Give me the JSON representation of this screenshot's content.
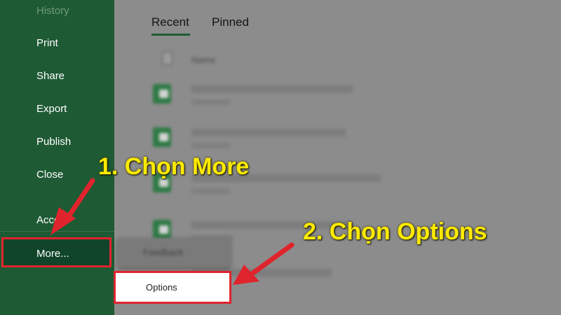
{
  "sidebar": {
    "items": [
      {
        "label": "History"
      },
      {
        "label": "Print"
      },
      {
        "label": "Share"
      },
      {
        "label": "Export"
      },
      {
        "label": "Publish"
      },
      {
        "label": "Close"
      },
      {
        "label": "Acco"
      },
      {
        "label": "More..."
      }
    ]
  },
  "main": {
    "tabs": [
      {
        "label": "Recent",
        "active": true
      },
      {
        "label": "Pinned",
        "active": false
      }
    ],
    "column_header": "Name"
  },
  "popup": {
    "feedback_label": "Feedback",
    "options_label": "Options"
  },
  "annotations": {
    "step1": "1. Chọn More",
    "step2": "2. Chọn Options"
  },
  "colors": {
    "sidebar_bg": "#1e5a34",
    "highlight_red": "#e0242d",
    "annotation_yellow": "#ffea00"
  }
}
